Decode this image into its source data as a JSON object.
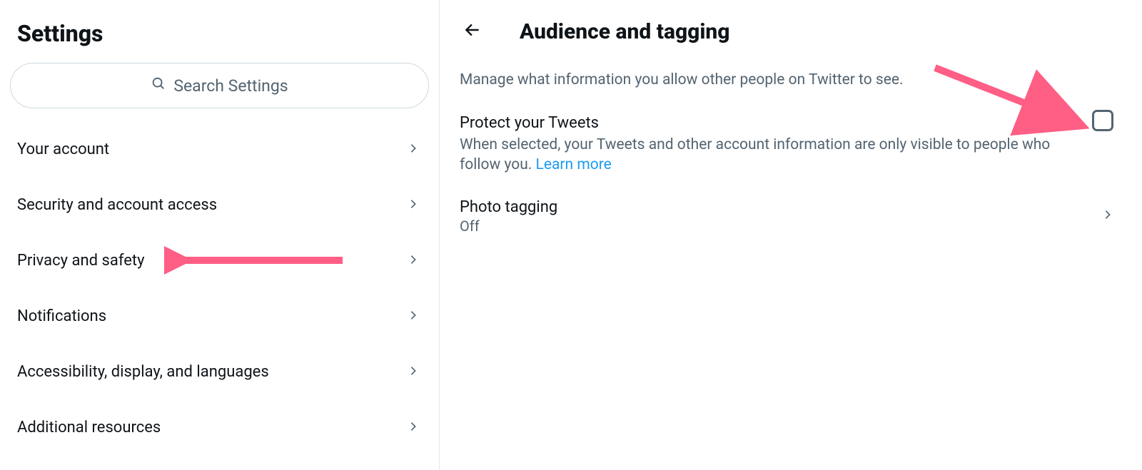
{
  "sidebar": {
    "title": "Settings",
    "search_placeholder": "Search Settings",
    "items": [
      {
        "label": "Your account"
      },
      {
        "label": "Security and account access"
      },
      {
        "label": "Privacy and safety"
      },
      {
        "label": "Notifications"
      },
      {
        "label": "Accessibility, display, and languages"
      },
      {
        "label": "Additional resources"
      }
    ]
  },
  "main": {
    "title": "Audience and tagging",
    "subtitle": "Manage what information you allow other people on Twitter to see.",
    "protect": {
      "title": "Protect your Tweets",
      "description": "When selected, your Tweets and other account information are only visible to people who follow you. ",
      "learn_more": "Learn more"
    },
    "photo_tagging": {
      "title": "Photo tagging",
      "value": "Off"
    }
  }
}
